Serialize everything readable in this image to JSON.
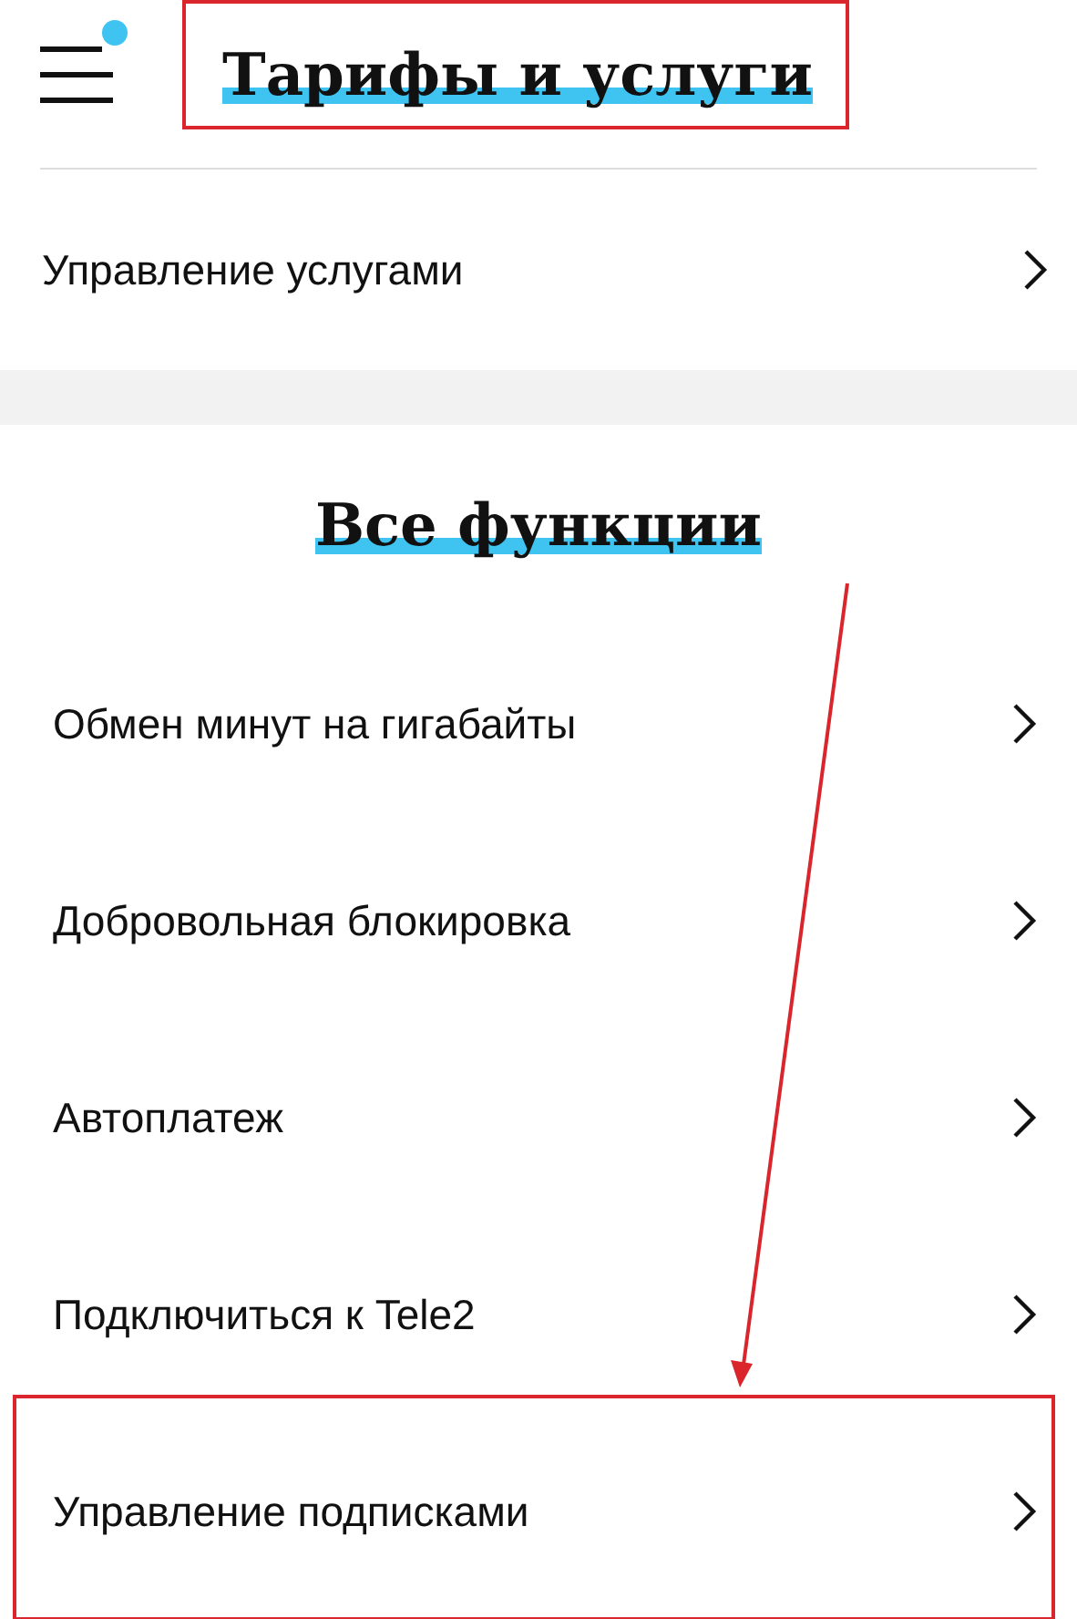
{
  "header": {
    "title": "Тарифы и услуги",
    "title_highlighted": true,
    "menu_badge": true
  },
  "top_rows": [
    {
      "label": "Управление услугами",
      "highlighted": false
    }
  ],
  "section": {
    "title": "Все функции"
  },
  "rows": [
    {
      "label": "Обмен минут на гигабайты",
      "highlighted": false
    },
    {
      "label": "Добровольная блокировка",
      "highlighted": false
    },
    {
      "label": "Автоплатеж",
      "highlighted": false
    },
    {
      "label": "Подключиться к Tele2",
      "highlighted": false
    },
    {
      "label": "Управление подписками",
      "highlighted": true
    }
  ]
}
